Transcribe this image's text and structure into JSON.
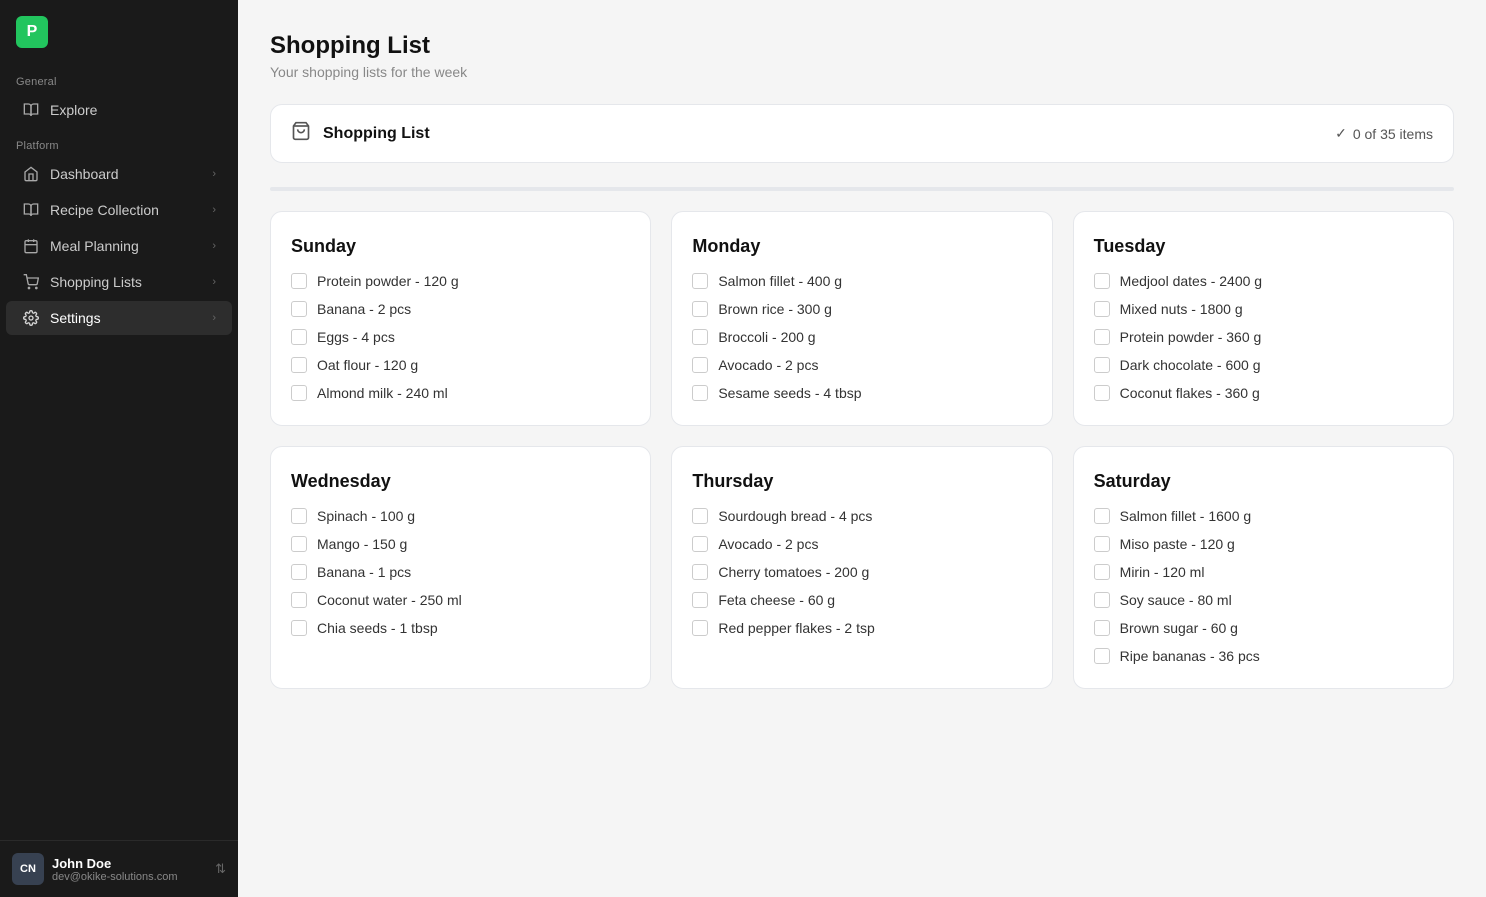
{
  "app": {
    "logo_letter": "P",
    "logo_bg": "#22c55e"
  },
  "sidebar": {
    "general_label": "General",
    "platform_label": "Platform",
    "items_general": [
      {
        "id": "explore",
        "label": "Explore",
        "icon": "book",
        "has_chevron": false,
        "active": false
      }
    ],
    "items_platform": [
      {
        "id": "dashboard",
        "label": "Dashboard",
        "icon": "home",
        "has_chevron": true,
        "active": false
      },
      {
        "id": "recipe-collection",
        "label": "Recipe Collection",
        "icon": "book",
        "has_chevron": true,
        "active": false
      },
      {
        "id": "meal-planning",
        "label": "Meal Planning",
        "icon": "calendar",
        "has_chevron": true,
        "active": false
      },
      {
        "id": "shopping-lists",
        "label": "Shopping Lists",
        "icon": "cart",
        "has_chevron": true,
        "active": false
      },
      {
        "id": "settings",
        "label": "Settings",
        "icon": "gear",
        "has_chevron": true,
        "active": true
      }
    ],
    "user": {
      "initials": "CN",
      "name": "John Doe",
      "email": "dev@okike-solutions.com"
    }
  },
  "page": {
    "title": "Shopping List",
    "subtitle": "Your shopping lists for the week"
  },
  "banner": {
    "title": "Shopping List",
    "progress_text": "0 of 35 items"
  },
  "days": [
    {
      "id": "sunday",
      "title": "Sunday",
      "items": [
        "Protein powder - 120 g",
        "Banana - 2 pcs",
        "Eggs - 4 pcs",
        "Oat flour - 120 g",
        "Almond milk - 240 ml"
      ]
    },
    {
      "id": "monday",
      "title": "Monday",
      "items": [
        "Salmon fillet - 400 g",
        "Brown rice - 300 g",
        "Broccoli - 200 g",
        "Avocado - 2 pcs",
        "Sesame seeds - 4 tbsp"
      ]
    },
    {
      "id": "tuesday",
      "title": "Tuesday",
      "items": [
        "Medjool dates - 2400 g",
        "Mixed nuts - 1800 g",
        "Protein powder - 360 g",
        "Dark chocolate - 600 g",
        "Coconut flakes - 360 g"
      ]
    },
    {
      "id": "wednesday",
      "title": "Wednesday",
      "items": [
        "Spinach - 100 g",
        "Mango - 150 g",
        "Banana - 1 pcs",
        "Coconut water - 250 ml",
        "Chia seeds - 1 tbsp"
      ]
    },
    {
      "id": "thursday",
      "title": "Thursday",
      "items": [
        "Sourdough bread - 4 pcs",
        "Avocado - 2 pcs",
        "Cherry tomatoes - 200 g",
        "Feta cheese - 60 g",
        "Red pepper flakes - 2 tsp"
      ]
    },
    {
      "id": "saturday",
      "title": "Saturday",
      "items": [
        "Salmon fillet - 1600 g",
        "Miso paste - 120 g",
        "Mirin - 120 ml",
        "Soy sauce - 80 ml",
        "Brown sugar - 60 g",
        "Ripe bananas - 36 pcs"
      ]
    }
  ]
}
